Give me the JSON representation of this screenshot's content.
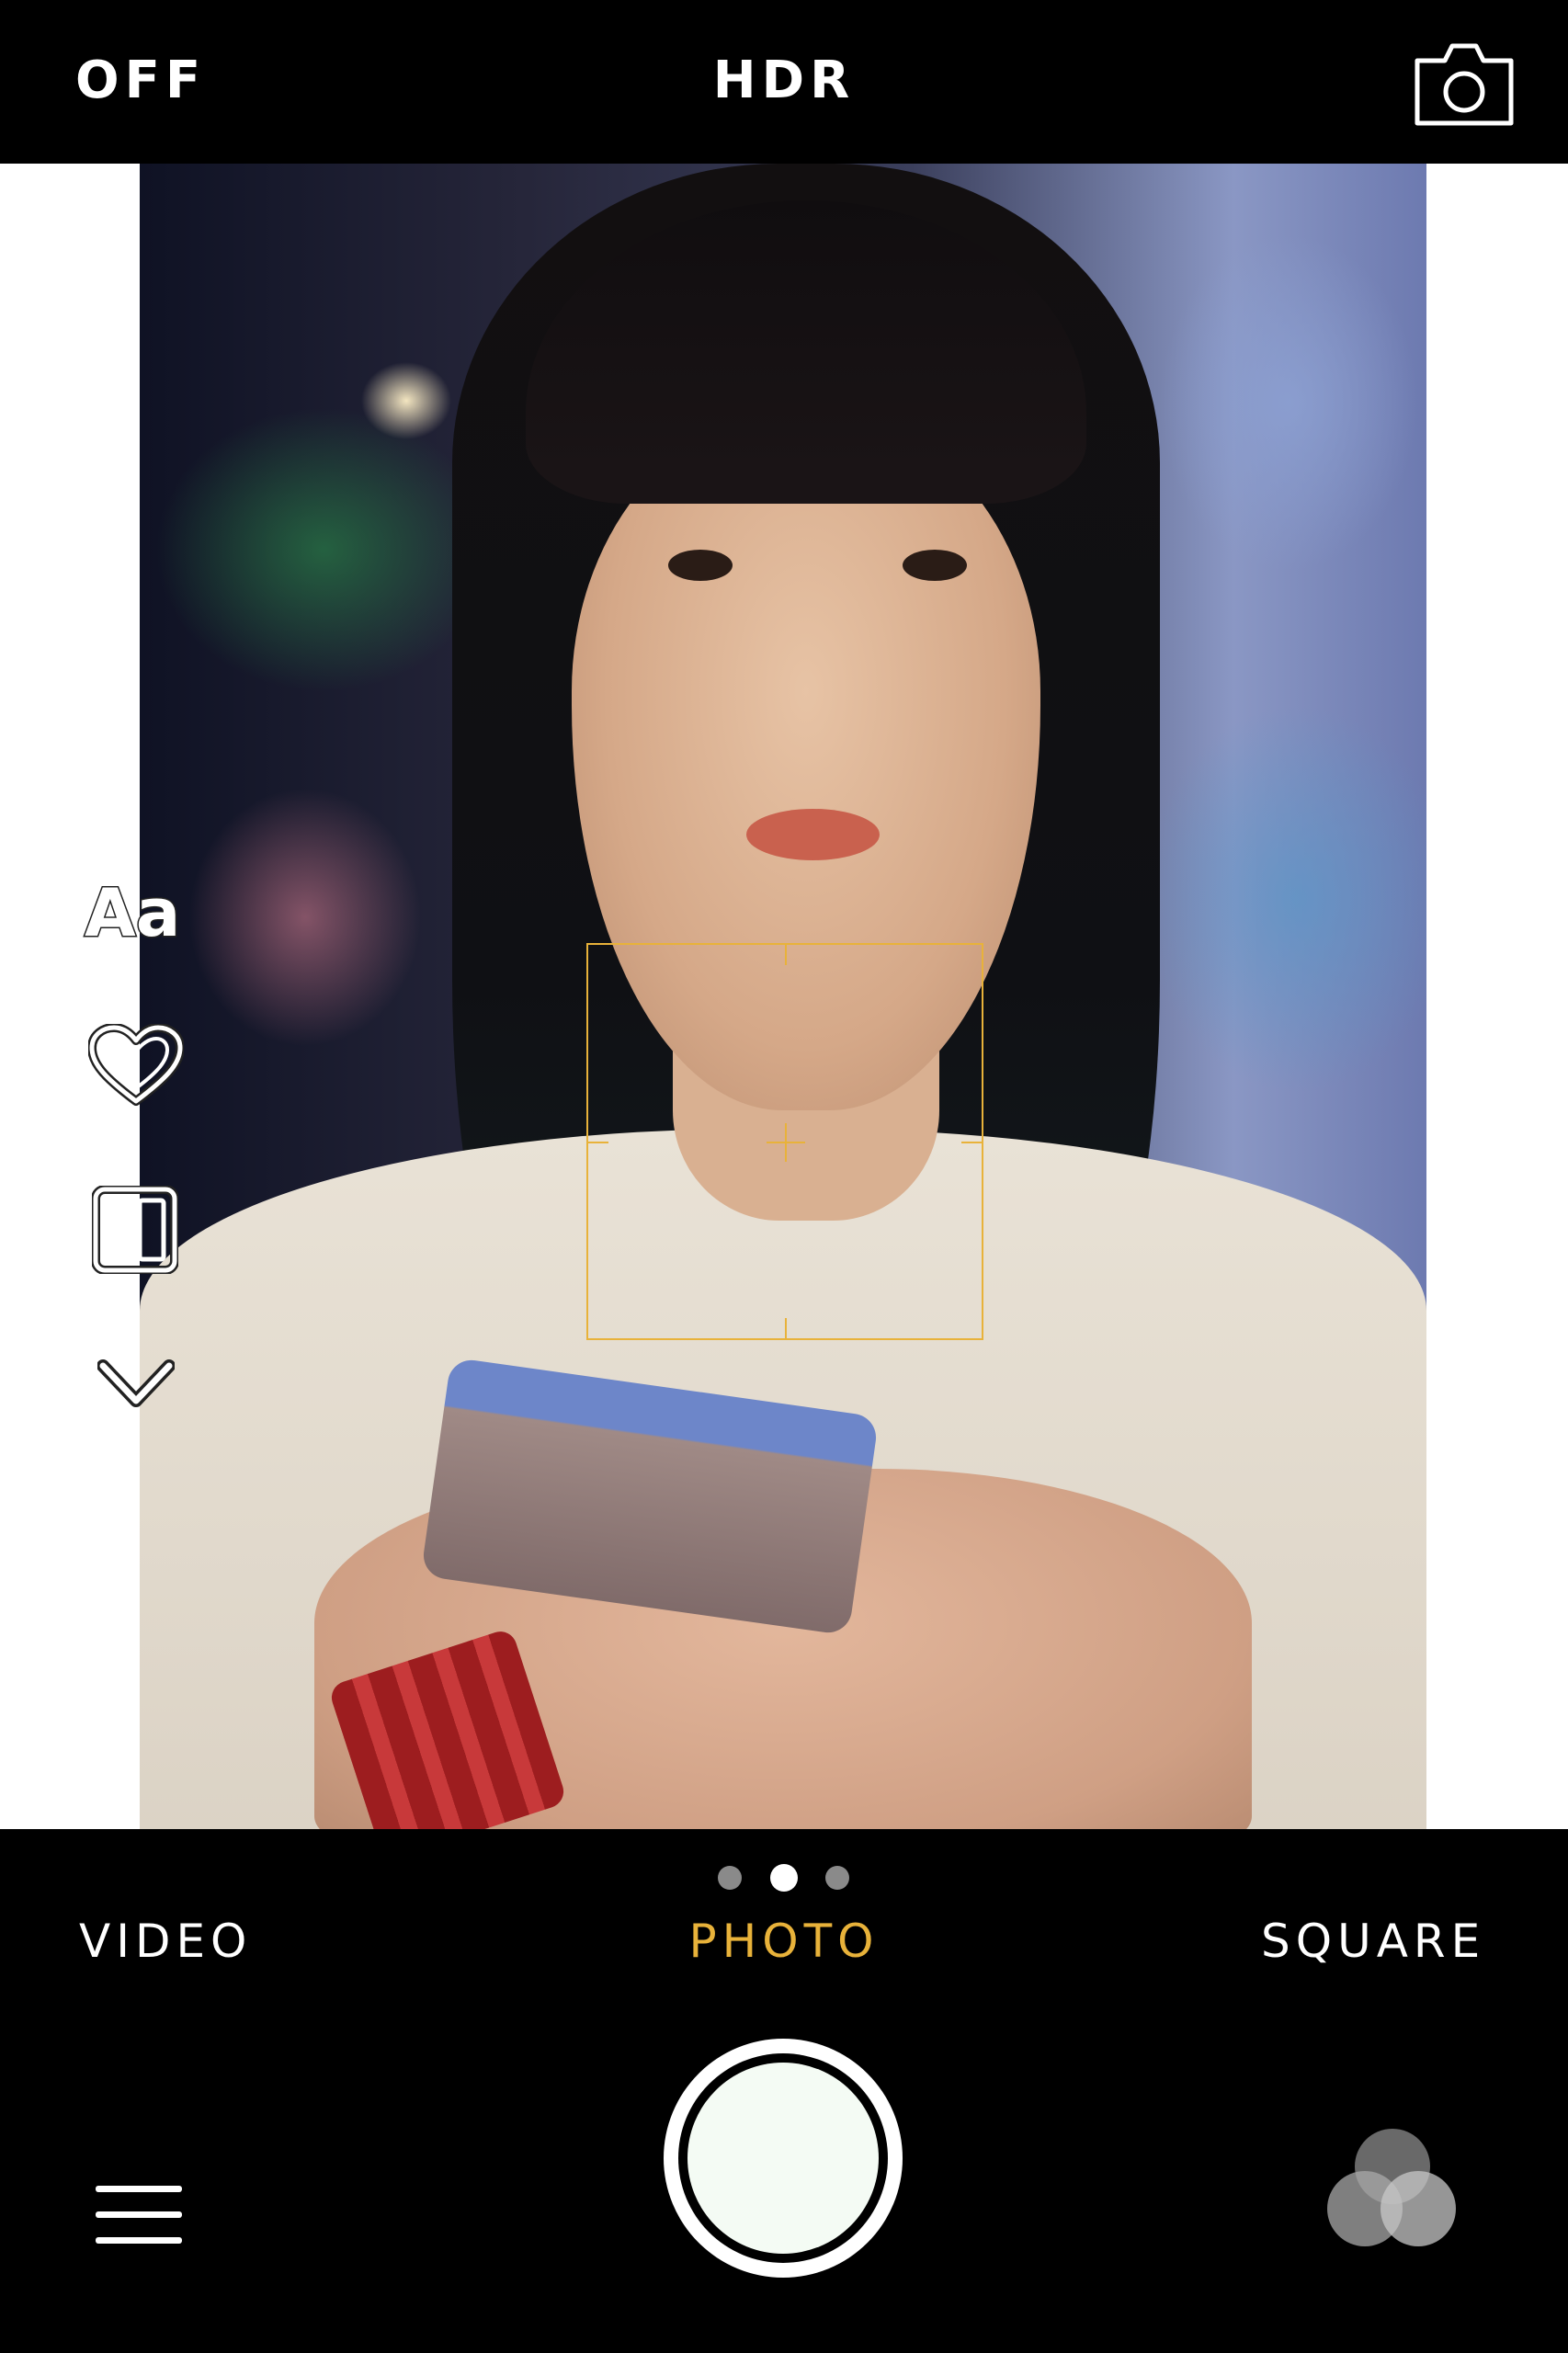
{
  "top_bar": {
    "flash_label": "OFF",
    "hdr_label": "HDR",
    "camera_switch_icon": "camera-switch-icon"
  },
  "sidebar": {
    "icons": [
      "text-icon",
      "heart-icon",
      "layout-icon",
      "chevron-down-icon"
    ],
    "text_icon_label": "Aa"
  },
  "viewfinder": {
    "focus_color": "#e8b23a"
  },
  "pager": {
    "total": 3,
    "active_index": 1
  },
  "modes": {
    "video": "VIDEO",
    "photo": "PHOTO",
    "square": "SQUARE",
    "active": "photo",
    "active_color": "#e8b23a"
  },
  "bottom_bar": {
    "shutter_icon": "shutter-button",
    "menu_icon": "menu-icon",
    "filters_icon": "filters-icon"
  }
}
